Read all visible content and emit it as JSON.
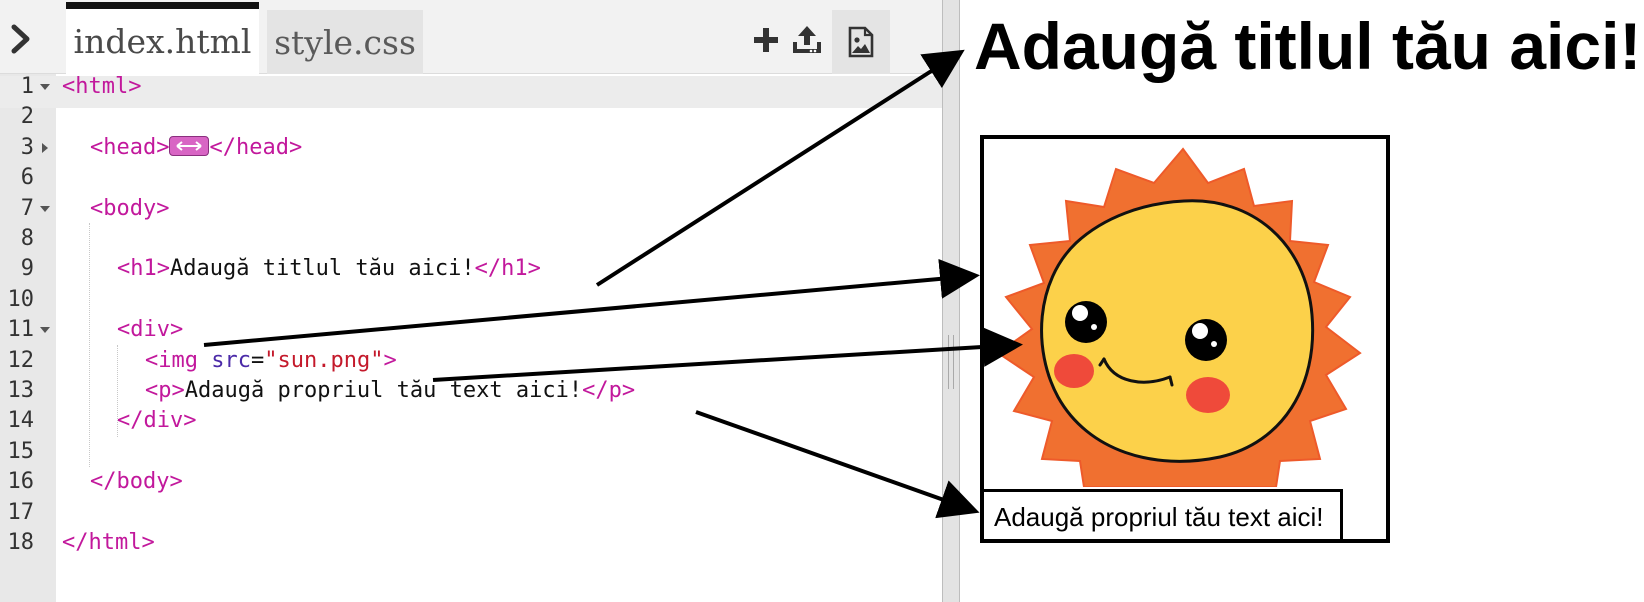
{
  "tabs": [
    {
      "label": "index.html",
      "active": true
    },
    {
      "label": "style.css",
      "active": false
    }
  ],
  "toolbar": {
    "icons": [
      "chevron-right-icon",
      "plus-icon",
      "upload-icon",
      "image-icon"
    ]
  },
  "line_numbers": [
    "1",
    "2",
    "3",
    "6",
    "7",
    "8",
    "9",
    "10",
    "11",
    "12",
    "13",
    "14",
    "15",
    "16",
    "17",
    "18"
  ],
  "code": {
    "line1": {
      "tag": "<html>"
    },
    "line3": {
      "open": "<head>",
      "close": "</head>"
    },
    "line7": {
      "tag": "<body>"
    },
    "line9": {
      "open": "<h1>",
      "text": "Adaugă titlul tău aici!",
      "close": "</h1>"
    },
    "line11": {
      "tag": "<div>"
    },
    "line12": {
      "open": "<img ",
      "attr": "src",
      "eq": "=",
      "value": "\"sun.png\"",
      "close": ">"
    },
    "line13": {
      "open": "<p>",
      "text": "Adaugă propriul tău text aici!",
      "close": "</p>"
    },
    "line14": {
      "tag": "</div>"
    },
    "line16": {
      "tag": "</body>"
    },
    "line18": {
      "tag": "</html>"
    }
  },
  "preview": {
    "heading": "Adaugă titlul tău aici!",
    "paragraph": "Adaugă propriul tău text aici!",
    "image_icon": "smiling-sun-image"
  },
  "colors": {
    "tag": "#c2189c",
    "attribute": "#4b2aa8",
    "string": "#c4192b",
    "sun_rays": "#f07030",
    "sun_face": "#fcd14a",
    "cheeks": "#ef4a3a"
  }
}
